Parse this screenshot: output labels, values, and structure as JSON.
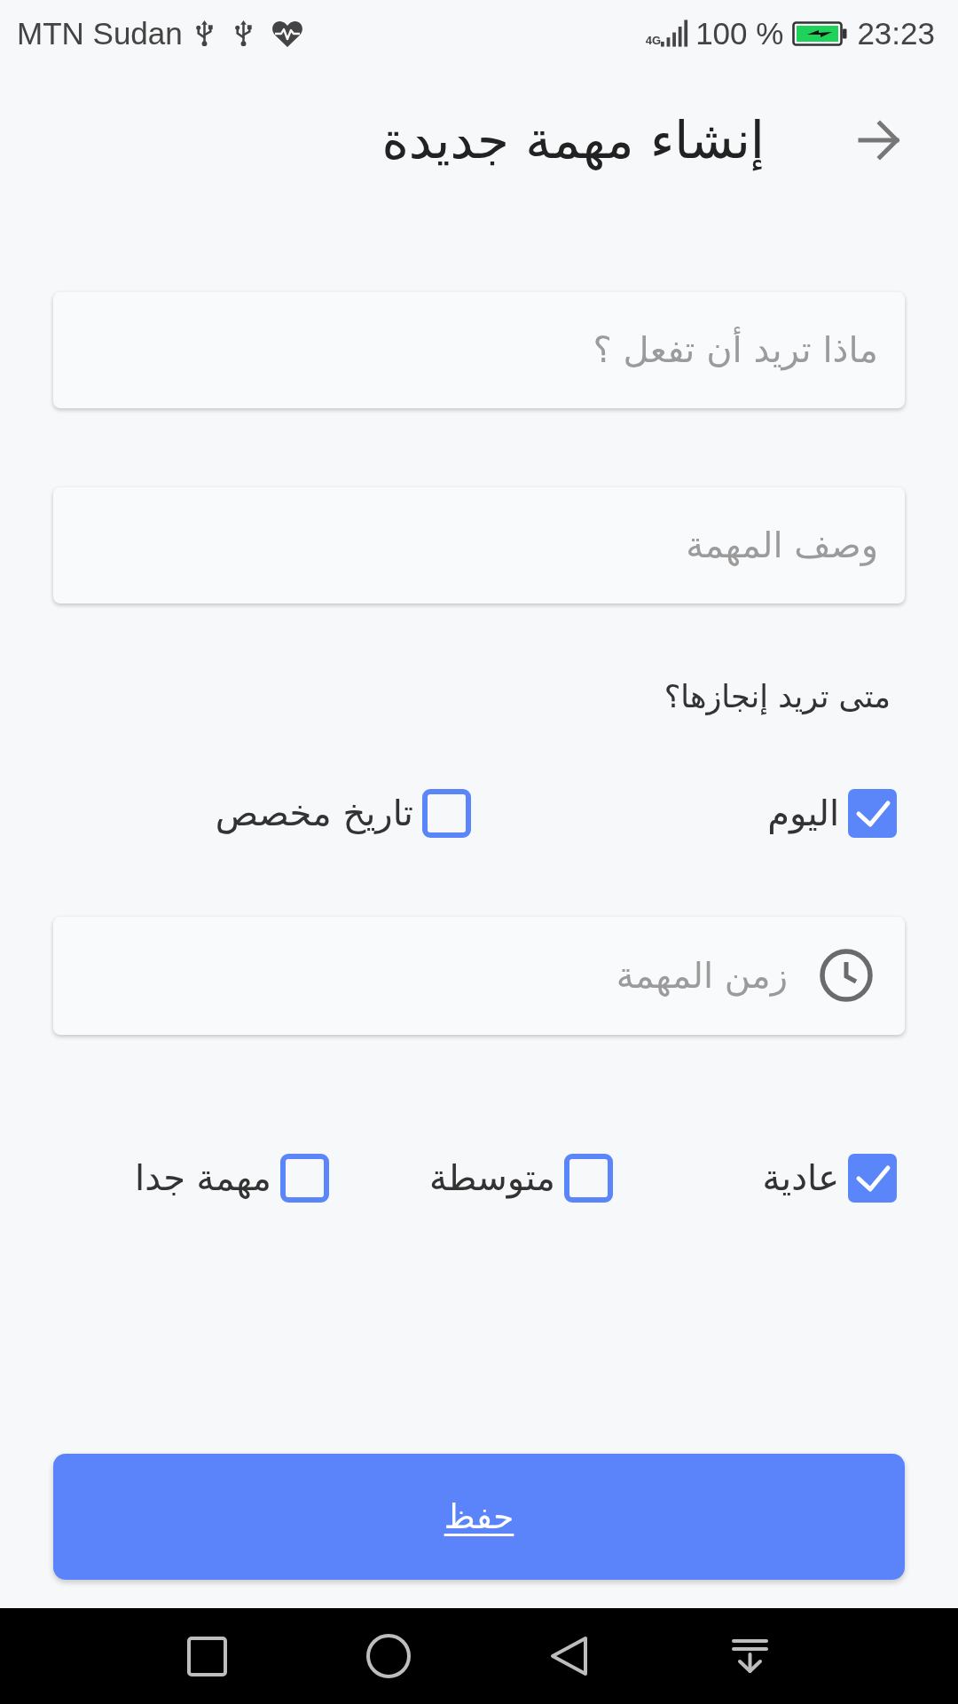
{
  "status_bar": {
    "carrier": "MTN Sudan",
    "network": "4G",
    "battery": "100 %",
    "time": "23:23"
  },
  "header": {
    "title": "إنشاء مهمة جديدة"
  },
  "task_field": {
    "placeholder": "ماذا تريد أن تفعل ؟"
  },
  "description_field": {
    "placeholder": "وصف المهمة"
  },
  "due_date": {
    "question": "متى تريد إنجازها؟",
    "options": [
      {
        "label": "اليوم",
        "checked": true
      },
      {
        "label": "تاريخ مخصص",
        "checked": false
      }
    ]
  },
  "time_field": {
    "placeholder": "زمن المهمة"
  },
  "priority": {
    "options": [
      {
        "label": "عادية",
        "checked": true
      },
      {
        "label": "متوسطة",
        "checked": false
      },
      {
        "label": "مهمة جدا",
        "checked": false
      }
    ]
  },
  "save_button": {
    "label": "حفظ"
  }
}
